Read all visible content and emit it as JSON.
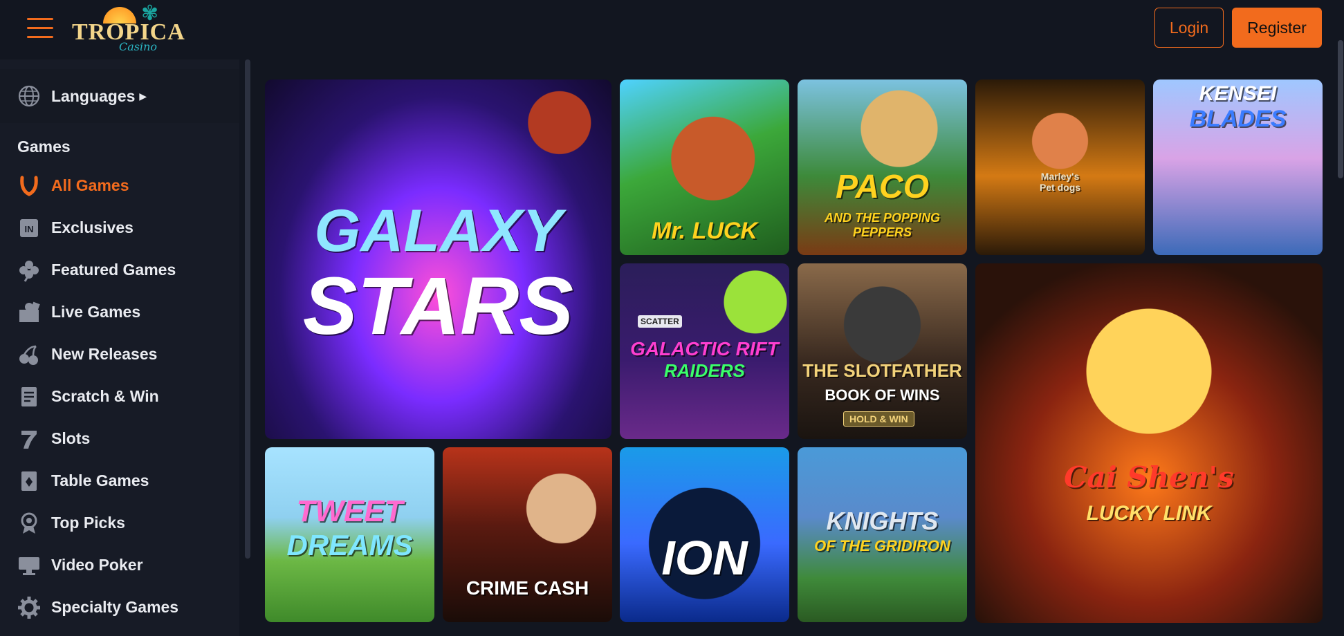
{
  "header": {
    "logo_main": "TROPICA",
    "logo_sub": "Casino",
    "login_label": "Login",
    "register_label": "Register"
  },
  "sidebar": {
    "languages_label": "Languages",
    "section_title": "Games",
    "items": [
      {
        "label": "All Games",
        "icon": "horseshoe-icon",
        "active": true
      },
      {
        "label": "Exclusives",
        "icon": "exclusive-badge-icon"
      },
      {
        "label": "Featured Games",
        "icon": "clover-icon"
      },
      {
        "label": "Live Games",
        "icon": "dealer-icon"
      },
      {
        "label": "New Releases",
        "icon": "cherries-icon"
      },
      {
        "label": "Scratch & Win",
        "icon": "scratch-ticket-icon"
      },
      {
        "label": "Slots",
        "icon": "seven-icon"
      },
      {
        "label": "Table Games",
        "icon": "playing-card-icon"
      },
      {
        "label": "Top Picks",
        "icon": "award-ribbon-icon"
      },
      {
        "label": "Video Poker",
        "icon": "monitor-icon"
      },
      {
        "label": "Specialty Games",
        "icon": "gear-icon"
      }
    ]
  },
  "games": [
    {
      "title_line1": "GALAXY",
      "title_line2": "STARS"
    },
    {
      "title_line1": "Mr. LUCK",
      "title_line2": ""
    },
    {
      "title_line1": "PACO",
      "title_line2": "AND THE POPPING PEPPERS"
    },
    {
      "title_line1": "Marley's",
      "title_line2": "Pet dogs"
    },
    {
      "title_line1": "KENSEI",
      "title_line2": "BLADES"
    },
    {
      "title_line1": "GALACTIC RIFT",
      "title_line2": "RAIDERS",
      "badge": "SCATTER"
    },
    {
      "title_line1": "THE SLOTFATHER",
      "title_line2": "BOOK OF WINS",
      "badge": "HOLD & WIN"
    },
    {
      "title_line1": "Cai Shen's",
      "title_line2": "LUCKY LINK"
    },
    {
      "title_line1": "TWEET",
      "title_line2": "DREAMS"
    },
    {
      "title_line1": "CRIME CASH",
      "title_line2": ""
    },
    {
      "title_line1": "ION",
      "title_line2": ""
    },
    {
      "title_line1": "KNIGHTS",
      "title_line2": "OF THE GRIDIRON"
    }
  ]
}
